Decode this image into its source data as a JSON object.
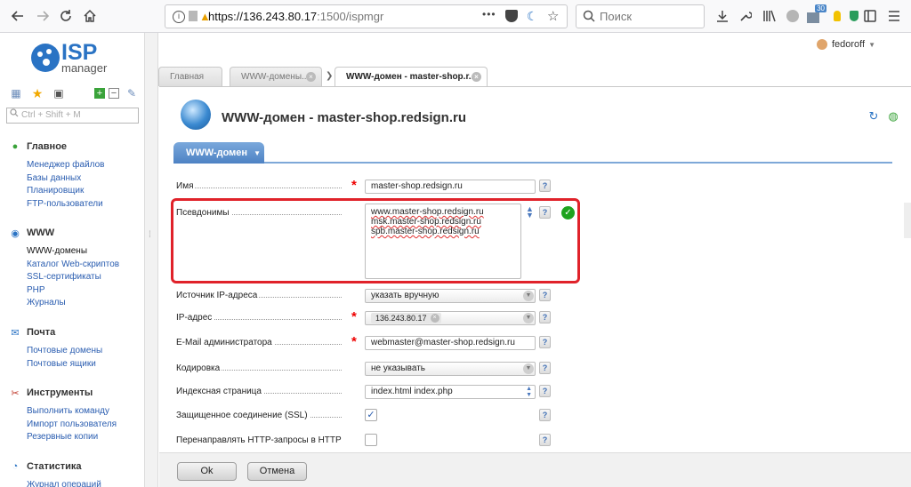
{
  "browser": {
    "url_host": "https://136.243.80.17",
    "url_path": ":1500/ispmgr",
    "search_placeholder": "Поиск",
    "badge_count": "30",
    "url_dots": "•••"
  },
  "logo": {
    "line1": "ISP",
    "line2": "manager"
  },
  "user": {
    "name": "fedoroff"
  },
  "sidebar": {
    "search_placeholder": "Ctrl + Shift + M",
    "sections": [
      {
        "title": "Главное",
        "icon": "home-icon",
        "items": [
          "Менеджер файлов",
          "Базы данных",
          "Планировщик",
          "FTP-пользователи"
        ]
      },
      {
        "title": "WWW",
        "icon": "globe-icon",
        "items": [
          "WWW-домены",
          "Каталог Web-скриптов",
          "SSL-сертификаты",
          "PHP",
          "Журналы"
        ]
      },
      {
        "title": "Почта",
        "icon": "mail-icon",
        "items": [
          "Почтовые домены",
          "Почтовые ящики"
        ]
      },
      {
        "title": "Инструменты",
        "icon": "tools-icon",
        "items": [
          "Выполнить команду",
          "Импорт пользователя",
          "Резервные копии"
        ]
      },
      {
        "title": "Статистика",
        "icon": "stats-icon",
        "items": [
          "Журнал операций"
        ]
      }
    ]
  },
  "tabs": [
    {
      "label": "Главная",
      "closable": false
    },
    {
      "label": "WWW-домены...",
      "closable": true
    },
    {
      "label": "WWW-домен - master-shop.r...",
      "closable": true
    }
  ],
  "page": {
    "title": "WWW-домен - master-shop.redsign.ru",
    "form_tab": "WWW-домен"
  },
  "form": {
    "name_label": "Имя",
    "name_value": "master-shop.redsign.ru",
    "aliases_label": "Псевдонимы",
    "aliases": [
      "www.master-shop.redsign.ru",
      "msk.master-shop.redsign.ru",
      "spb.master-shop.redsign.ru"
    ],
    "ip_source_label": "Источник IP-адреса",
    "ip_source_value": "указать вручную",
    "ip_label": "IP-адрес",
    "ip_value": "136.243.80.17",
    "email_label": "E-Mail администратора",
    "email_value": "webmaster@master-shop.redsign.ru",
    "encoding_label": "Кодировка",
    "encoding_value": "не указывать",
    "index_label": "Индексная страница",
    "index_value": "index.html index.php",
    "ssl_label": "Защищенное соединение (SSL)",
    "ssl_checked": true,
    "redirect_label": "Перенаправлять HTTP-запросы в HTTPS",
    "redirect_checked": false,
    "help": "?"
  },
  "buttons": {
    "ok": "Ok",
    "cancel": "Отмена"
  }
}
